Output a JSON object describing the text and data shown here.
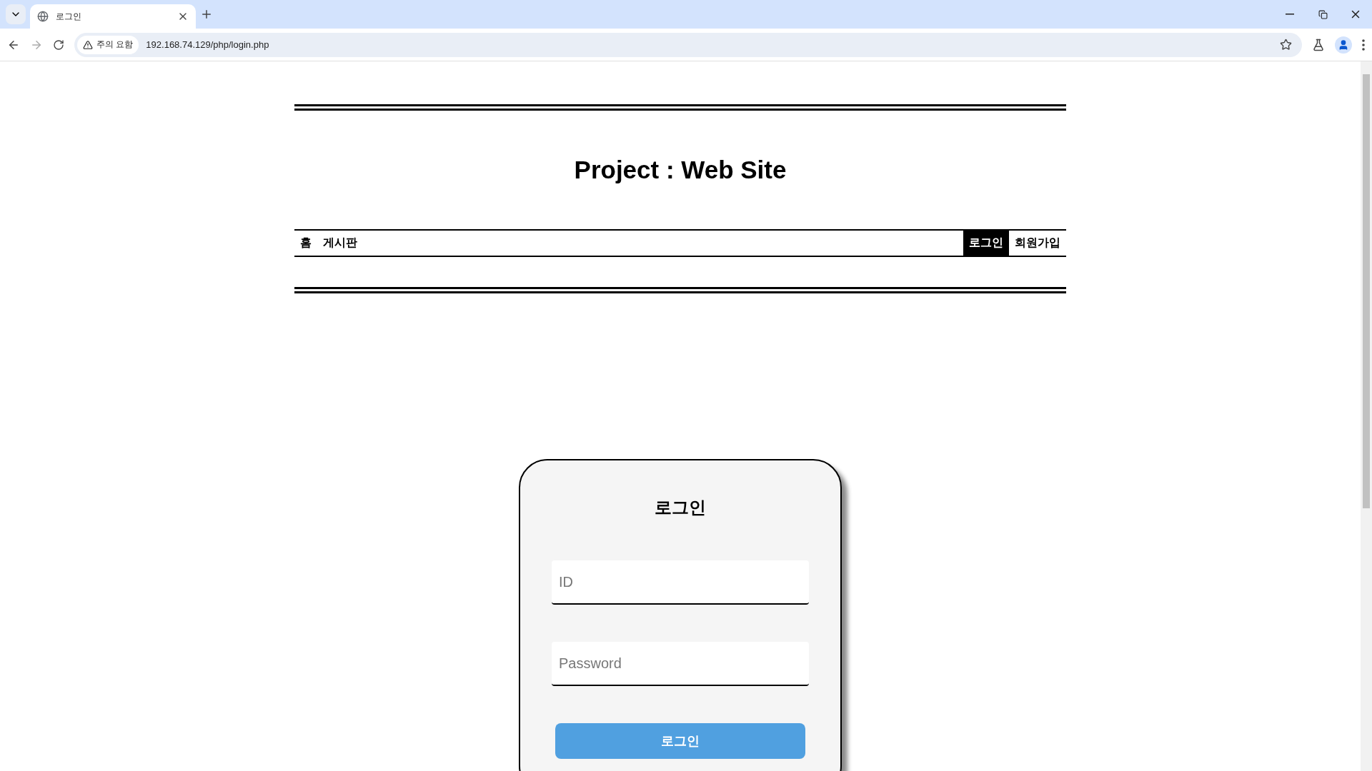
{
  "browser": {
    "tab_title": "로그인",
    "security_label": "주의 요함",
    "url": "192.168.74.129/php/login.php"
  },
  "site": {
    "title": "Project : Web Site"
  },
  "nav": {
    "left": [
      {
        "label": "홈",
        "selected": false
      },
      {
        "label": "게시판",
        "selected": false
      }
    ],
    "right": [
      {
        "label": "로그인",
        "selected": true
      },
      {
        "label": "회원가입",
        "selected": false
      }
    ]
  },
  "login": {
    "title": "로그인",
    "fields": [
      {
        "placeholder": "ID"
      },
      {
        "placeholder": "Password"
      }
    ],
    "button": "로그인"
  }
}
